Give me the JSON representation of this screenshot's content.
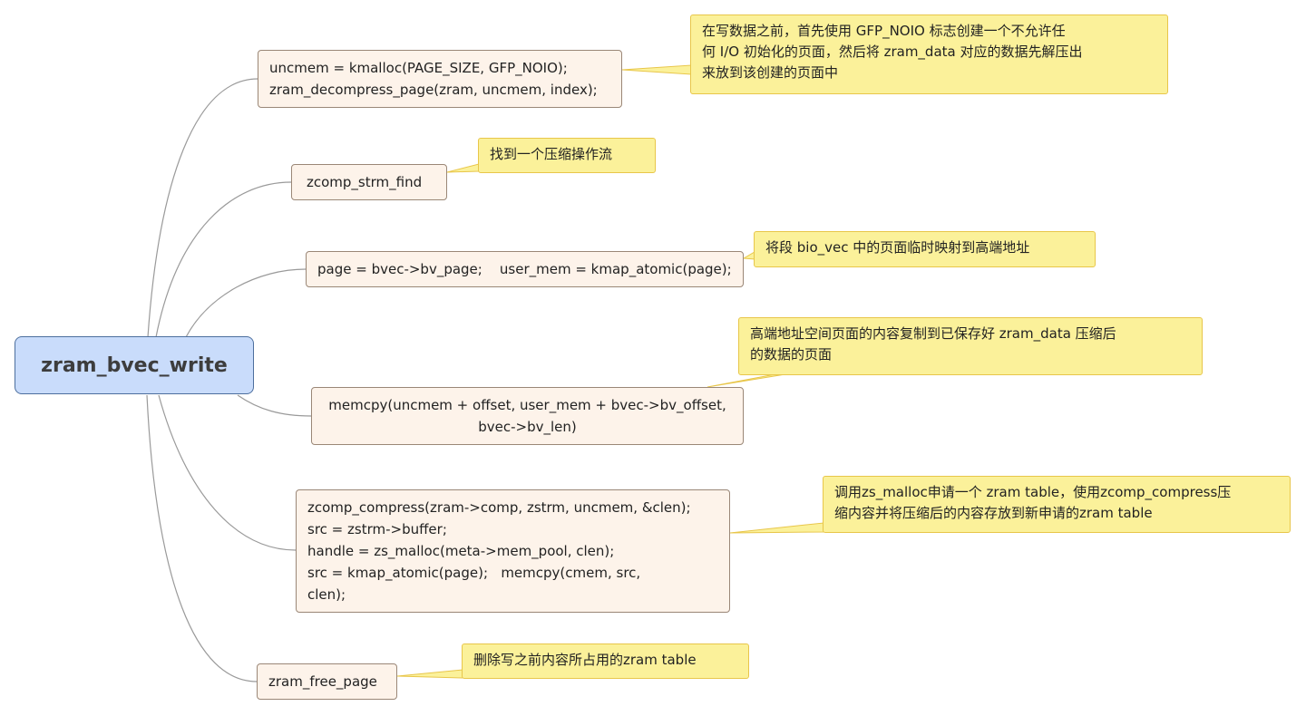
{
  "root": {
    "label": "zram_bvec_write"
  },
  "steps": [
    {
      "lines": [
        "uncmem = kmalloc(PAGE_SIZE, GFP_NOIO);",
        "zram_decompress_page(zram, uncmem, index);"
      ],
      "note": [
        "在写数据之前，首先使用 GFP_NOIO 标志创建一个不允许任",
        "何 I/O 初始化的页面，然后将 zram_data 对应的数据先解压出",
        "来放到该创建的页面中"
      ]
    },
    {
      "lines": [
        "zcomp_strm_find"
      ],
      "note": [
        "找到一个压缩操作流"
      ]
    },
    {
      "lines": [
        "page = bvec->bv_page;    user_mem = kmap_atomic(page);"
      ],
      "note": [
        "将段 bio_vec 中的页面临时映射到高端地址"
      ]
    },
    {
      "lines": [
        "memcpy(uncmem + offset, user_mem + bvec->bv_offset,",
        "bvec->bv_len)"
      ],
      "note": [
        "高端地址空间页面的内容复制到已保存好 zram_data 压缩后",
        "的数据的页面"
      ]
    },
    {
      "lines": [
        "zcomp_compress(zram->comp, zstrm, uncmem, &clen);",
        "src = zstrm->buffer;",
        "handle = zs_malloc(meta->mem_pool, clen);",
        "src = kmap_atomic(page);   memcpy(cmem, src,",
        "clen);"
      ],
      "note": [
        "调用zs_malloc申请一个 zram table，使用zcomp_compress压",
        "缩内容并将压缩后的内容存放到新申请的zram table"
      ]
    },
    {
      "lines": [
        "zram_free_page"
      ],
      "note": [
        "删除写之前内容所占用的zram table"
      ]
    }
  ]
}
